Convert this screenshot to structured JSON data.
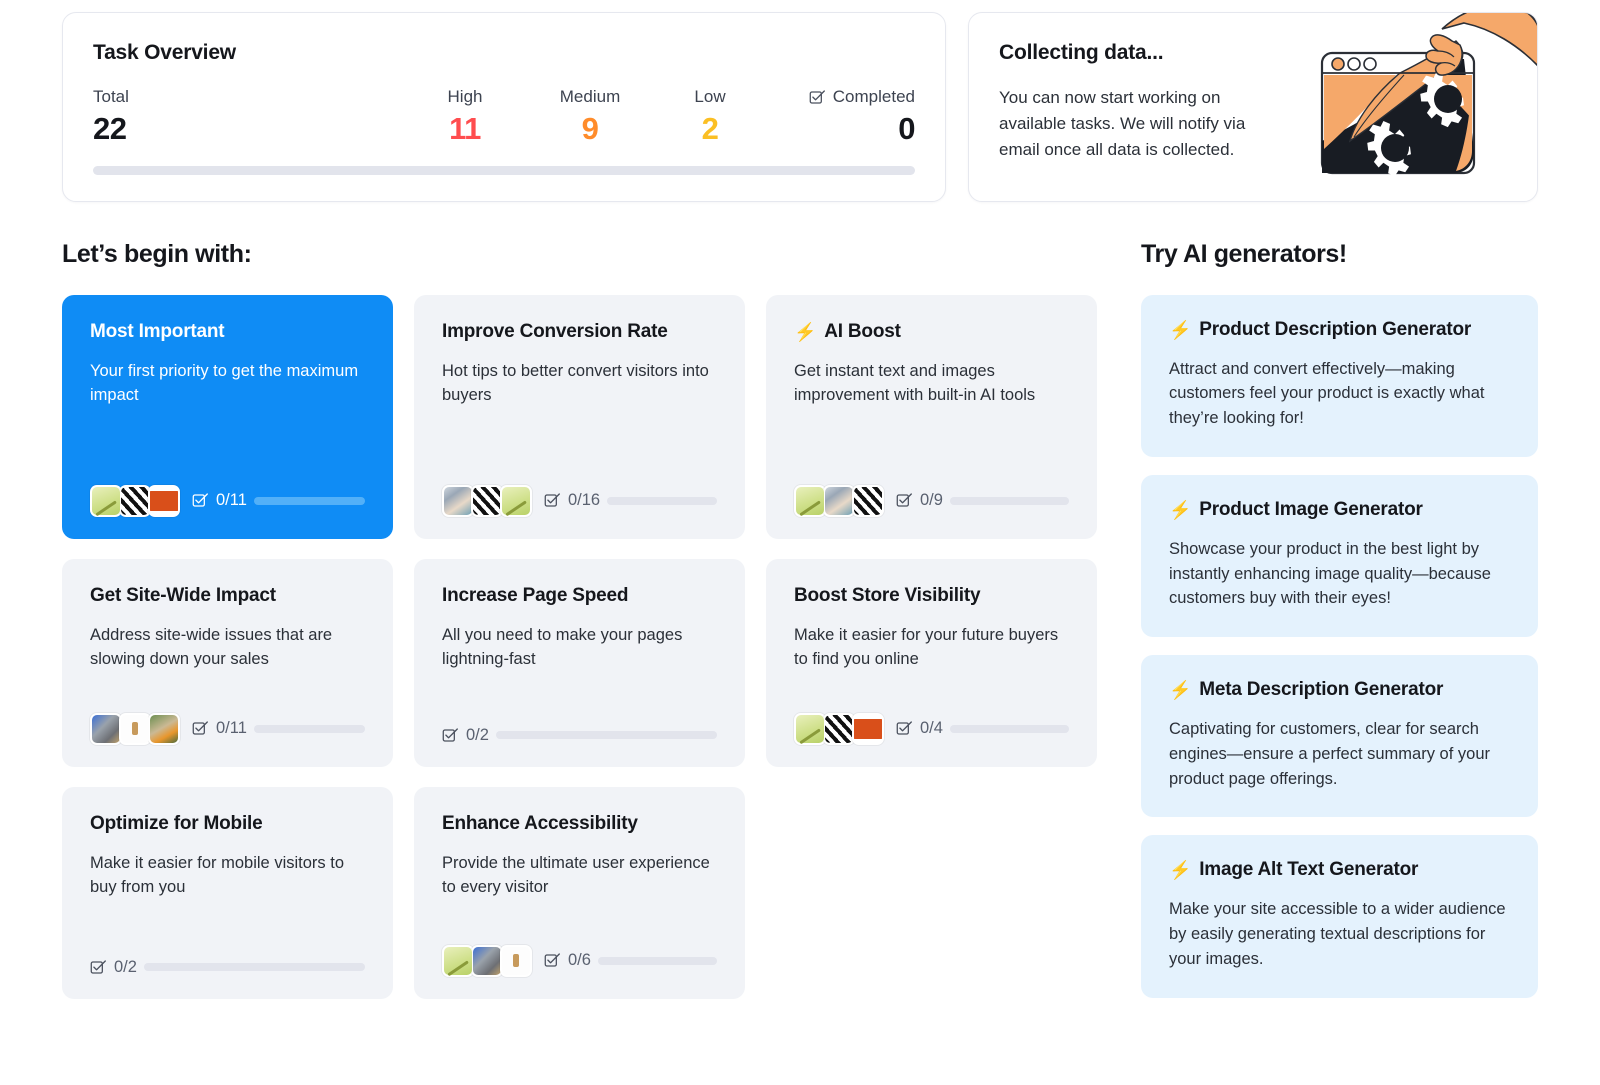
{
  "task_overview": {
    "title": "Task Overview",
    "stats": [
      {
        "label": "Total",
        "value": "22",
        "color": "#15171c"
      },
      {
        "label": "High",
        "value": "11",
        "color": "#ff4d4f"
      },
      {
        "label": "Medium",
        "value": "9",
        "color": "#ff8c2b"
      },
      {
        "label": "Low",
        "value": "2",
        "color": "#fbbf24"
      },
      {
        "label": "Completed",
        "value": "0",
        "color": "#15171c"
      }
    ],
    "progress_percent": 0,
    "track_color": "#e2e4ec"
  },
  "collecting": {
    "title": "Collecting data...",
    "text": "You can now start working on available tasks. We will notify via email once all data is collected.",
    "illustration": "browser-peel-gears-illustration"
  },
  "tasks_section": {
    "heading": "Let’s begin with:",
    "cards": [
      {
        "title": "Most Important",
        "desc": "Your first priority to get the maximum impact",
        "featured": true,
        "bolt": false,
        "thumbs": [
          "th-green",
          "th-checker",
          "th-orange"
        ],
        "counter": "0/11"
      },
      {
        "title": "Improve Conversion Rate",
        "desc": "Hot tips to better convert visitors into buyers",
        "featured": false,
        "bolt": false,
        "thumbs": [
          "th-desk",
          "th-checker",
          "th-green"
        ],
        "counter": "0/16"
      },
      {
        "title": "AI Boost",
        "desc": "Get instant text and images improvement with built-in AI tools",
        "featured": false,
        "bolt": true,
        "thumbs": [
          "th-green",
          "th-desk",
          "th-checker"
        ],
        "counter": "0/9"
      },
      {
        "title": "Get Site-Wide Impact",
        "desc": "Address site-wide issues that are slowing down your sales",
        "featured": false,
        "bolt": false,
        "thumbs": [
          "th-cat",
          "th-bottle",
          "th-plant"
        ],
        "counter": "0/11"
      },
      {
        "title": "Increase Page Speed",
        "desc": "All you need to make your pages lightning-fast",
        "featured": false,
        "bolt": false,
        "thumbs": [],
        "counter": "0/2"
      },
      {
        "title": "Boost Store Visibility",
        "desc": "Make it easier for your future buyers to find you online",
        "featured": false,
        "bolt": false,
        "thumbs": [
          "th-green",
          "th-checker",
          "th-orange"
        ],
        "counter": "0/4"
      },
      {
        "title": "Optimize for Mobile",
        "desc": "Make it easier for mobile visitors to buy from you",
        "featured": false,
        "bolt": false,
        "thumbs": [],
        "counter": "0/2"
      },
      {
        "title": "Enhance Accessibility",
        "desc": "Provide the ultimate user experience to every visitor",
        "featured": false,
        "bolt": false,
        "thumbs": [
          "th-green",
          "th-cat",
          "th-bottle"
        ],
        "counter": "0/6"
      }
    ]
  },
  "ai_section": {
    "heading": "Try AI generators!",
    "cards": [
      {
        "title": "Product Description Generator",
        "desc": "Attract and convert effectively—making customers feel your product is exactly what they’re looking for!"
      },
      {
        "title": "Product Image Generator",
        "desc": "Showcase your product in the best light by instantly enhancing image quality—because customers buy with their eyes!"
      },
      {
        "title": "Meta Description Generator",
        "desc": "Captivating for customers, clear for search engines—ensure a perfect summary of your product page offerings."
      },
      {
        "title": "Image Alt Text Generator",
        "desc": "Make your site accessible to a wider audience by easily generating textual descriptions for your images."
      }
    ]
  },
  "icons": {
    "bolt": "⚡",
    "checkbox_checked": "checkbox-check-icon"
  },
  "colors": {
    "accent_blue": "#0f8cf5",
    "card_gray": "#f1f3f7",
    "ai_card_blue": "#e4f2fd",
    "high": "#ff4d4f",
    "medium": "#ff8c2b",
    "low": "#fbbf24",
    "track": "#e2e4ec"
  }
}
